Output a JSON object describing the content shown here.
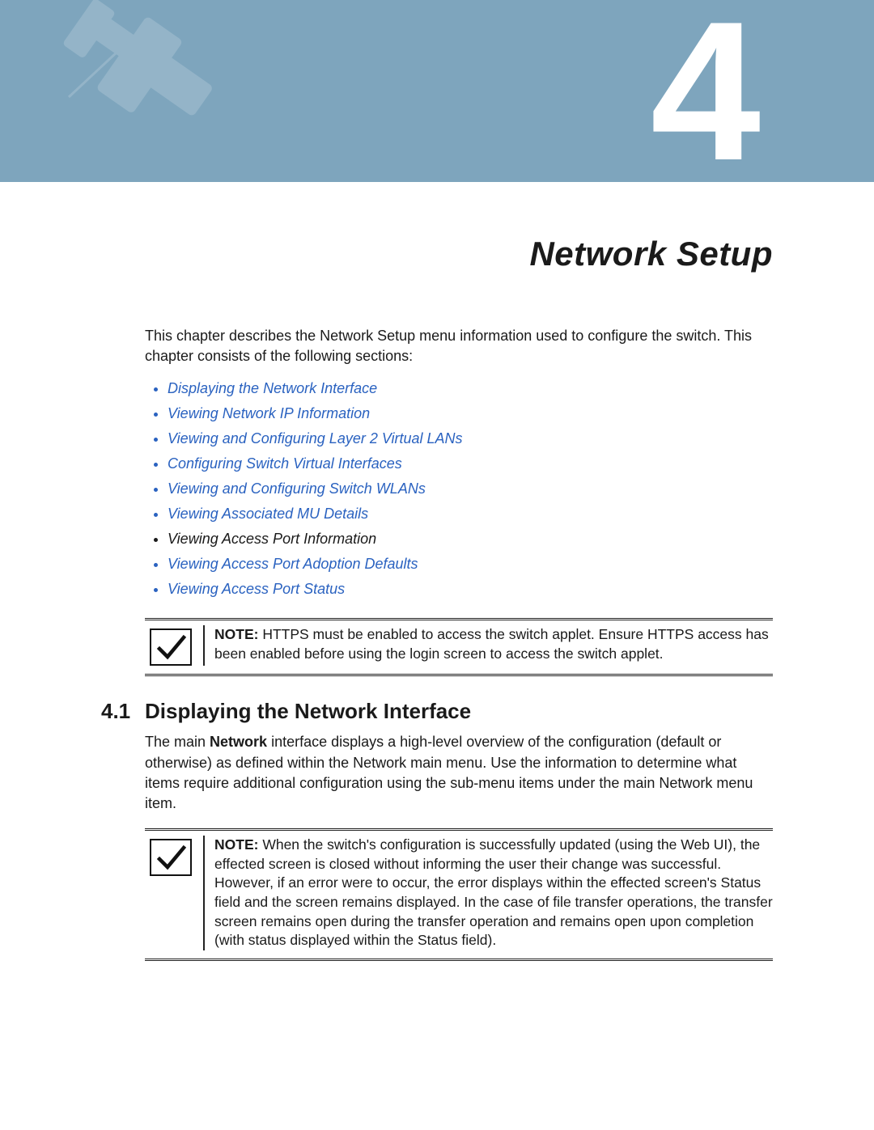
{
  "chapter_number": "4",
  "chapter_title": "Network Setup",
  "intro": "This chapter describes the Network Setup menu information used to configure the switch. This chapter consists of the following sections:",
  "sections_list": [
    {
      "label": "Displaying the Network Interface",
      "link": true
    },
    {
      "label": "Viewing Network IP Information",
      "link": true
    },
    {
      "label": "Viewing and Configuring Layer 2 Virtual LANs",
      "link": true
    },
    {
      "label": "Configuring Switch Virtual Interfaces",
      "link": true
    },
    {
      "label": "Viewing and Configuring Switch WLANs",
      "link": true
    },
    {
      "label": "Viewing Associated MU Details",
      "link": true
    },
    {
      "label": "Viewing Access Port Information",
      "link": false
    },
    {
      "label": "Viewing Access Port Adoption Defaults",
      "link": true
    },
    {
      "label": "Viewing Access Port Status",
      "link": true
    }
  ],
  "note1": {
    "label": "NOTE:",
    "text": " HTTPS must be enabled to access the switch applet. Ensure HTTPS access has been enabled before using the login screen to access the switch applet."
  },
  "section_4_1": {
    "number": "4.1",
    "title": "Displaying the Network Interface",
    "body_pre": "The main ",
    "body_kw": "Network",
    "body_post": " interface displays a high-level overview of the configuration (default or otherwise) as defined within the Network main menu. Use the information to determine what items require additional configuration using the sub-menu items under the main Network menu item."
  },
  "note2": {
    "label": "NOTE:",
    "text": " When the switch's configuration is successfully updated (using the Web UI), the effected screen is closed without informing the user their change was successful. However, if an error were to occur, the error displays within the effected screen's Status field and the screen remains displayed. In the case of file transfer operations, the transfer screen remains open during the transfer operation and remains open upon completion (with status displayed within the Status field)."
  }
}
